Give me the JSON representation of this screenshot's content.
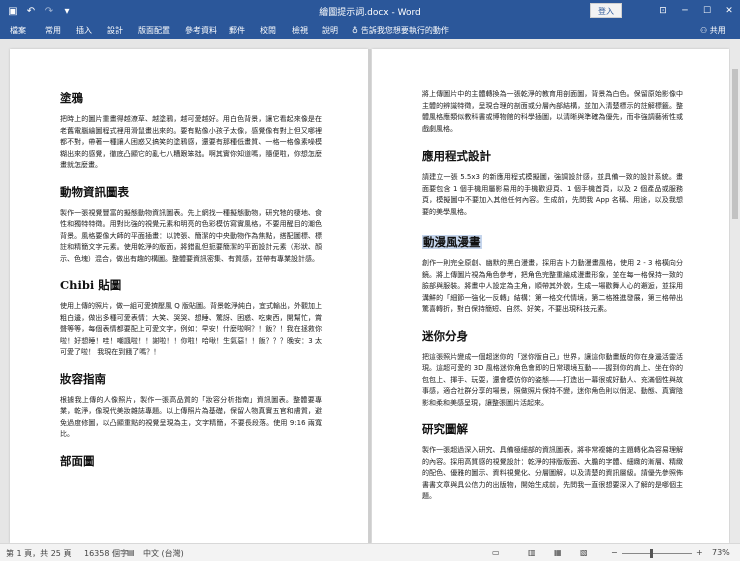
{
  "titlebar": {
    "title": "繪圖提示詞.docx - Word",
    "login": "登入",
    "icons": [
      "save-icon",
      "undo-icon",
      "redo-icon",
      "customize-icon"
    ]
  },
  "ribbon": {
    "tabs": [
      "檔案",
      "常用",
      "插入",
      "設計",
      "版面配置",
      "參考資料",
      "郵件",
      "校閱",
      "檢視",
      "說明"
    ],
    "tell_me": "告訴我您想要執行的動作",
    "share": "共用"
  },
  "pages": {
    "left": [
      {
        "heading": "塗鴉",
        "body": "把時上的圖片重畫得越潦草、越塗鴉，越可愛越好。用白色背景，讓它看起來像是在老舊電腦繪圖程式裡用滑鼠畫出來的。要有點像小孩子太像，感覺像有對上但又哪裡都不對，帶著一種讓人困惑又搞笑的塗鴉感，還要有那種低畫質、一格一格像素噪模糊出來的感覺，徹底凸顯它的亂七八糟跟笨拙。啊其實你知道嗎，隨便啦，你想怎麼畫就怎麼畫。"
      },
      {
        "heading": "動物資訊圖表",
        "body": "製作一張視覺豐富的擬態動物資訊圖表。先上網找一種擬態動物，研究牠的棲地、食性和獨特特徵。用對比強的視覺元素和明亮的色彩模仿寫實風格，不要用醒目的潮色背景。風格要像大師的平面插畫：以誇張、簡潔的中央動物作為焦點，搭配圖標、標註和精簡文字元素。使用乾淨的版面，將錯亂但扼要簡潔的平面設計元素（形狀、顏示、色塊）混合，做出有趣的構圖。整體要資訊密集、有質感，並帶有專業設計感。"
      },
      {
        "heading": "Chibi 貼圖",
        "body": "使用上傳的照片，做一組可愛擠壓風 Q 版貼圖。背景乾淨純白，宜式輸出，外觀加上粗白邊，做出多種可愛表情：大笑、哭哭、想睡、驚訝、困惑、吃東西，開幫忙，賞聲等等，每個表情都要配上可愛文字，例如：早安！什麼啦啊？！飯？！我在拯救你啦！好想睡！哇！嘲諷啦！！謝啦！！你啦！哈啾！生氣惡！！飯？？？晚安：3 太可愛了啦！ 我現在到餓了嗎？！"
      },
      {
        "heading": "妝容指南",
        "body": "根據我上傳的人像照片，製作一張高品質的「妝容分析指南」資訊圖表。整體要專業，乾淨，像現代美妝雜誌專題。以上傳照片為基礎，保留人物真實五官和膚質，避免過度修圖，以凸顯重點的視覺呈現為主，文字精簡，不要長段落。使用 9:16 兩寬比。"
      },
      {
        "heading": "部面圖",
        "body": ""
      }
    ],
    "right": [
      {
        "heading": "",
        "body": "將上傳圖片中的主體轉換為一張乾淨的教育用剖面圖，背景為白色。保留原始影像中主體的辨識特徵，呈現合理的剖面或分層內部結構，並加入清楚標示的註解標籤。整體風格應類似教科書或博物館的科學插圖，以清晰與準確為優先，而非強調藝術性或戲劇風格。"
      },
      {
        "heading": "應用程式設計",
        "body": "請建立一張 5.5x3 的新應用程式模擬圖，強調設計感，並具備一致的設計系統。畫面要包含 1 個手機用屬影易用的手機歡迎頁、1 個手機首頁，以及 2 個產品或服務頁，模擬圖中不要加入其他任何內容。生成前，先問我 App 名稱、用途，以及我想要的美學風格。"
      },
      {
        "heading": "動漫風漫畫",
        "body": "創作一則完全原創、幽默的黑白漫畫，採用吉卜力動漫畫風格，使用 2 - 3 格橫向分鏡。將上傳圖片視為角色參考，把角色完整重繪成漫畫形象，並在每一格保持一致的臉部與服裝。將畫中人設定為主角，順帶其外貌，生成一場歡舞人心的邂逅，並採用溝鮮的「細節一強化一反轉」結構：第一格交代情境，第二格推進發展，第三格帶出驚喜轉折，對白保持簡短、自然、好笑，不要出現科技元素。"
      },
      {
        "heading": "迷你分身",
        "body": "把這張照片變成一個超迷你的「迷你版自己」世界，讓這你動畫版的你在身邊活靈活現。這超可愛的 3D 風格迷你角色會即的日常環境互動——握到你的肩上、坐在你的包包上、揮手、玩耍，還會模仿你的姿態——打造出一幕很或好動人、充滿個性與故事感，適合社群分享的場景，照做照片保持不變，迷你角色則以俏泥、動態、真實陰影和柔和美感呈現，讓整張圖片活起來。"
      },
      {
        "heading": "研究圖解",
        "body": "製作一張超過深入研究、具備極細部的資訊圖表，將非常複雜的主題轉化為容易理解的內容。採用高質感的視覺設計：乾淨的排版版面、大膽的字體、細緻的漸層、精緻的配色、優雅的圖示、資料視覺化、分層圖解，以及清楚的資訊層級。請優先參照佈書書文章與具公信力的出版物，開始生成前，先問我一直很想要深入了解的是哪個主題。"
      }
    ]
  },
  "statusbar": {
    "page": "第 1 頁，共 25 頁",
    "words": "16358 個字",
    "language": "中文 (台灣)",
    "zoom": "73%",
    "zoom_value": 0.73
  }
}
